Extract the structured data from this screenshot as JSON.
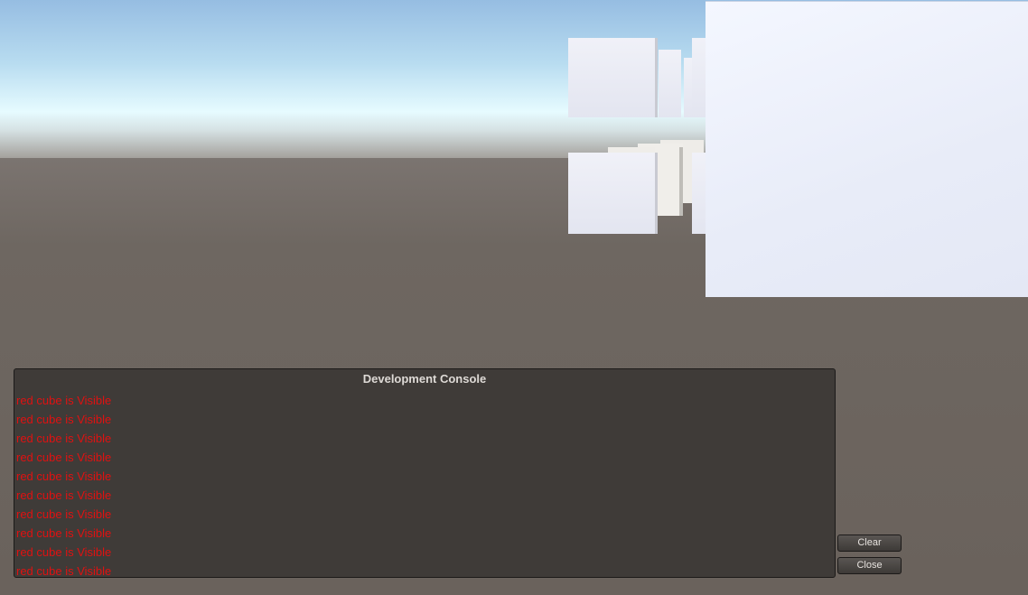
{
  "console": {
    "title": "Development Console",
    "lines": [
      "red cube is Visible",
      "red cube is Visible",
      "red cube is Visible",
      "red cube is Visible",
      "red cube is Visible",
      "red cube is Visible",
      "red cube is Visible",
      "red cube is Visible",
      "red cube is Visible",
      "red cube is Visible"
    ],
    "line_color": "#e01111"
  },
  "buttons": {
    "clear_label": "Clear",
    "close_label": "Close"
  }
}
